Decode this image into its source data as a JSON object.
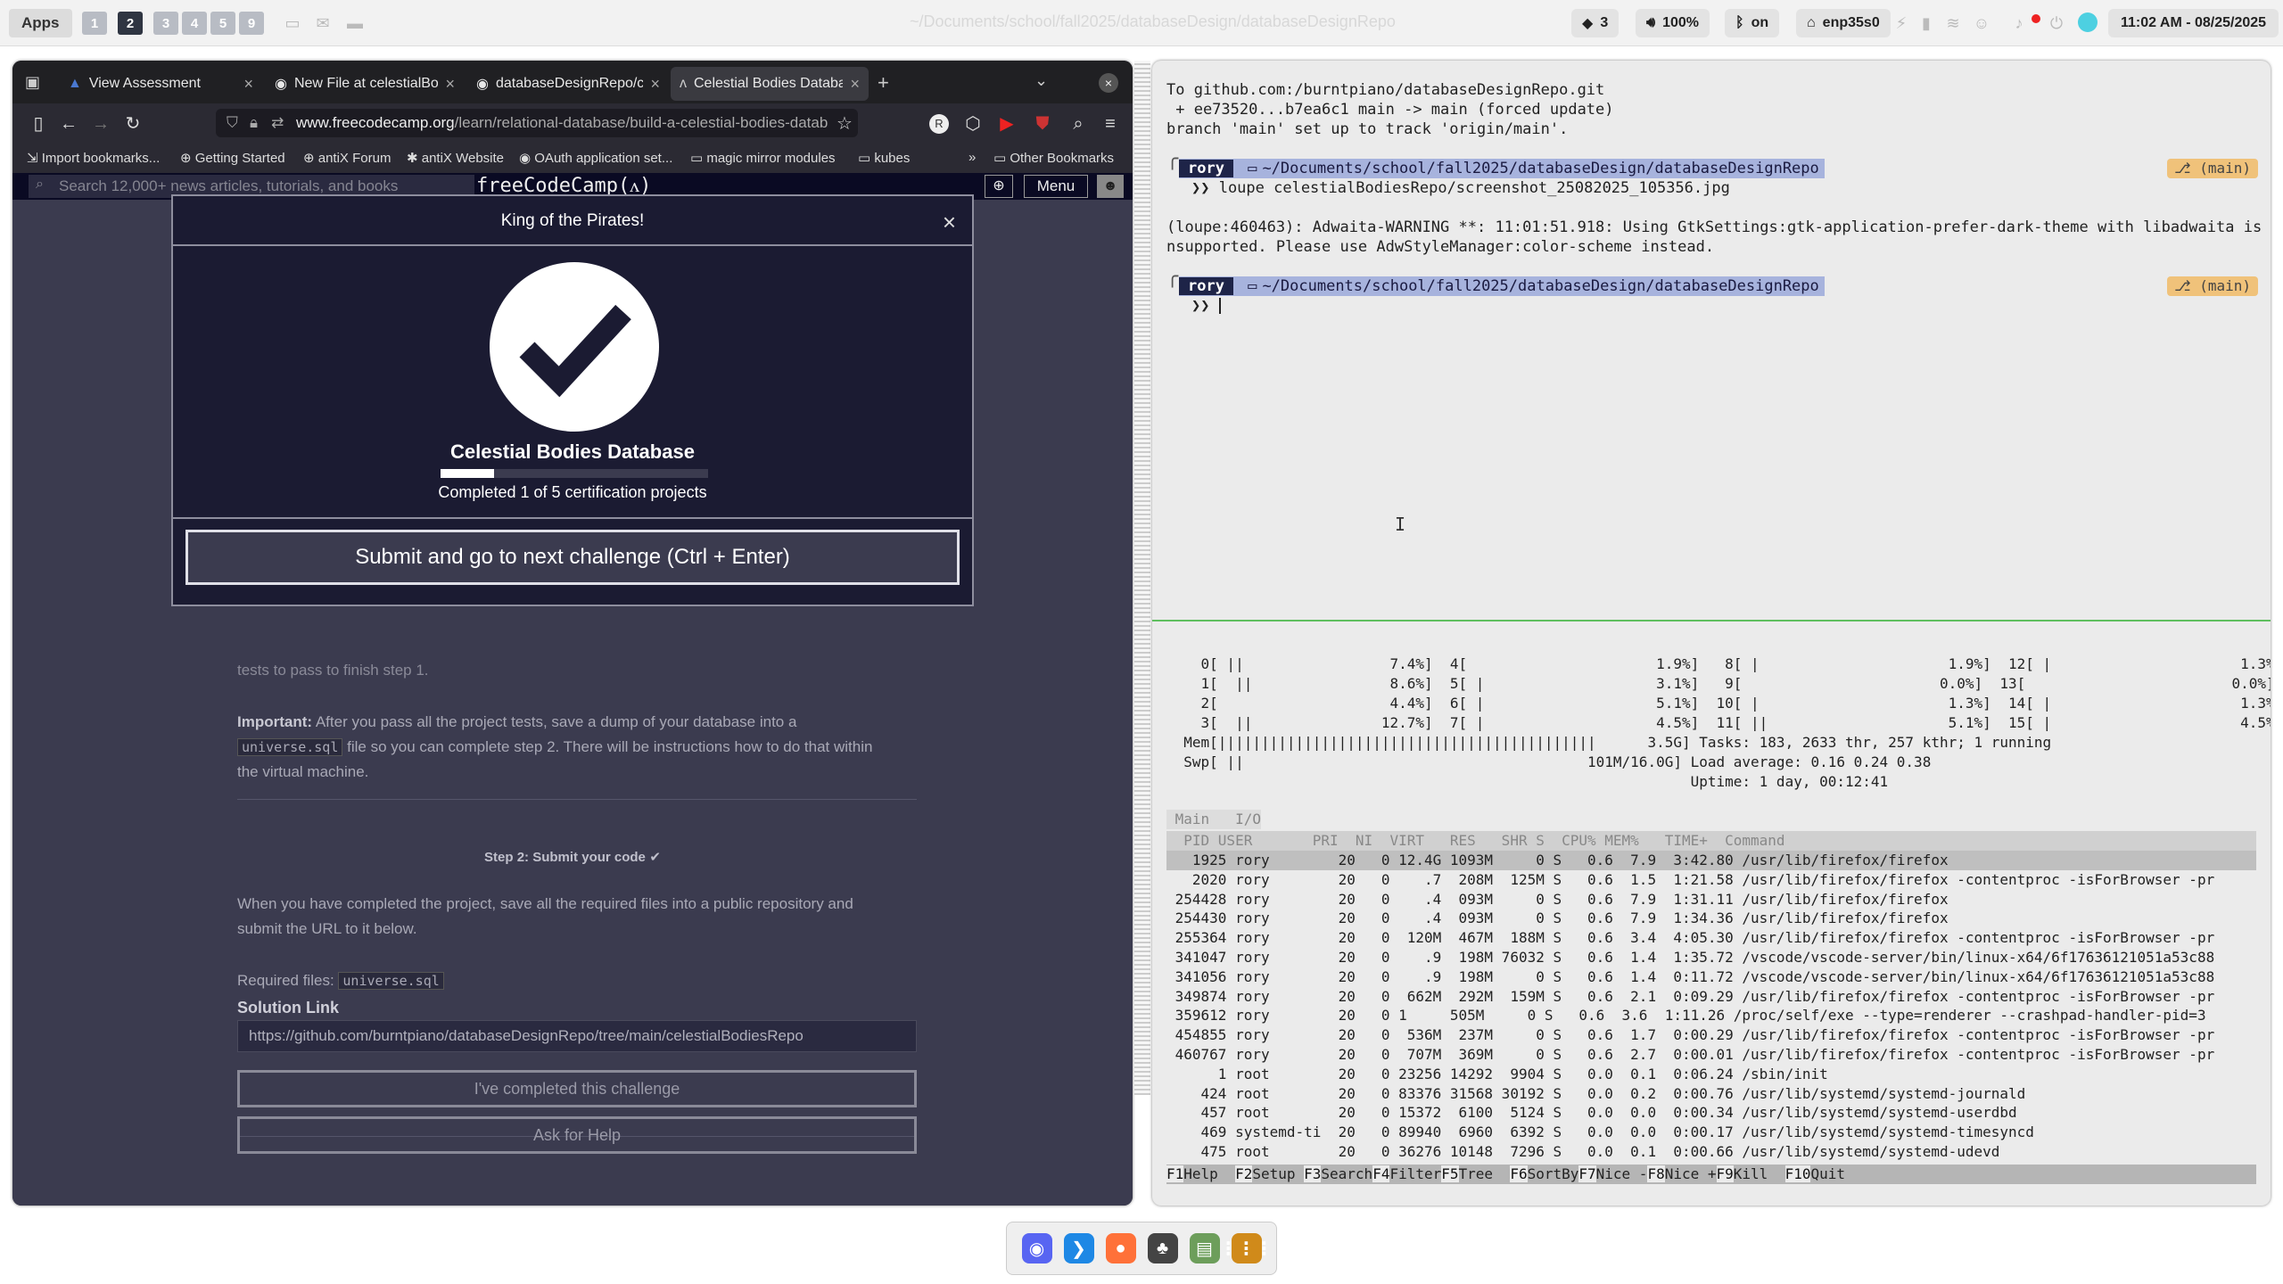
{
  "topbar": {
    "apps_label": "Apps",
    "workspaces": [
      "1",
      "2",
      "3",
      "4",
      "5",
      "9"
    ],
    "window_title": "~/Documents/school/fall2025/databaseDesign/databaseDesignRepo",
    "dropbox_count": "3",
    "volume": "100%",
    "bluetooth": "on",
    "network": "enp35s0",
    "datetime": "11:02 AM - 08/25/2025"
  },
  "browser": {
    "tabs": [
      {
        "label": "View Assessment"
      },
      {
        "label": "New File at celestialBod"
      },
      {
        "label": "databaseDesignRepo/ce"
      },
      {
        "label": "Celestial Bodies Databa"
      }
    ],
    "url_domain": "www.freecodecamp.org",
    "url_path": "/learn/relational-database/build-a-celestial-bodies-datab",
    "bookmarks": [
      "Import bookmarks...",
      "Getting Started",
      "antiX Forum",
      "antiX Website",
      "OAuth application set...",
      "magic mirror modules",
      "kubes"
    ],
    "other_bookmarks": "Other Bookmarks"
  },
  "fcc": {
    "search_placeholder": "Search 12,000+ news articles, tutorials, and books",
    "logo": "freeCodeCamp(ᴧ)",
    "menu_label": "Menu",
    "step1_tail": "tests to pass to finish step 1.",
    "important_label": "Important:",
    "important_text_a": "After you pass all the project tests, save a dump of your database into a",
    "important_code": "universe.sql",
    "important_text_b": "file so you can complete step 2. There will be instructions how to do that within",
    "important_text_c": "the virtual machine.",
    "step2_title": "Step 2: Submit your code",
    "step2_text_a": "When you have completed the project, save all the required files into a public repository and",
    "step2_text_b": "submit the URL to it below.",
    "required_files_label": "Required files:",
    "required_file": "universe.sql",
    "solution_label": "Solution Link",
    "solution_value": "https://github.com/burntpiano/databaseDesignRepo/tree/main/celestialBodiesRepo",
    "completed_button": "I've completed this challenge",
    "help_button": "Ask for Help"
  },
  "modal": {
    "title": "King of the Pirates!",
    "project_title": "Celestial Bodies Database",
    "progress_fraction": 0.2,
    "progress_text": "Completed 1 of 5 certification projects",
    "submit_label": "Submit and go to next challenge (Ctrl + Enter)"
  },
  "terminal": {
    "git_line1": "To github.com:/burntpiano/databaseDesignRepo.git",
    "git_line2": " + ee73520...b7ea6c1 main -> main (forced update)",
    "git_line3": "branch 'main' set up to track 'origin/main'.",
    "prompt_user": "rory",
    "prompt_path": "~/Documents/school/fall2025/databaseDesign/databaseDesignRepo",
    "branch": "(main)",
    "command1": "❯❯ loupe celestialBodiesRepo/screenshot_25082025_105356.jpg",
    "warn_line1": "(loupe:460463): Adwaita-WARNING **: 11:01:51.918: Using GtkSettings:gtk-application-prefer-dark-theme with libadwaita is u",
    "warn_line2": "nsupported. Please use AdwStyleManager:color-scheme instead.",
    "command2": "❯❯ "
  },
  "htop": {
    "cpus": [
      "    0[ ||                 7.4%]  4[                      1.9%]   8[ |                      1.9%]  12[ |                      1.3%]",
      "    1[  ||                8.6%]  5[ |                    3.1%]   9[                       0.0%]  13[                        0.0%]",
      "    2[                    4.4%]  6[ |                    5.1%]  10[ |                      1.3%]  14[ |                      1.3%]",
      "    3[  ||               12.7%]  7[ |                    4.5%]  11[ ||                     5.1%]  15[ |                      4.5%]"
    ],
    "mem_line": "  Mem[||||||||||||||||||||||||||||||||||||||||||||      3.5G] Tasks: 183, 2633 thr, 257 kthr; 1 running",
    "swp_line": "  Swp[ ||                                        101M/16.0G] Load average: 0.16 0.24 0.38",
    "uptime_line": "                                                             Uptime: 1 day, 00:12:41",
    "tabs": " Main   I/O",
    "header": "  PID USER       PRI  NI  VIRT   RES   SHR S  CPU% MEM%   TIME+  Command",
    "processes": [
      "   1925 rory        20   0 12.4G 1093M     0 S   0.6  7.9  3:42.80 /usr/lib/firefox/firefox",
      "   2020 rory        20   0    .7  208M  125M S   0.6  1.5  1:21.58 /usr/lib/firefox/firefox -contentproc -isForBrowser -pr",
      " 254428 rory        20   0    .4  093M     0 S   0.6  7.9  1:31.11 /usr/lib/firefox/firefox",
      " 254430 rory        20   0    .4  093M     0 S   0.6  7.9  1:34.36 /usr/lib/firefox/firefox",
      " 255364 rory        20   0  120M  467M  188M S   0.6  3.4  4:05.30 /usr/lib/firefox/firefox -contentproc -isForBrowser -pr",
      " 341047 rory        20   0    .9  198M 76032 S   0.6  1.4  1:35.72 /vscode/vscode-server/bin/linux-x64/6f17636121051a53c88",
      " 341056 rory        20   0    .9  198M     0 S   0.6  1.4  0:11.72 /vscode/vscode-server/bin/linux-x64/6f17636121051a53c88",
      " 349874 rory        20   0  662M  292M  159M S   0.6  2.1  0:09.29 /usr/lib/firefox/firefox -contentproc -isForBrowser -pr",
      " 359612 rory        20   0 1     505M     0 S   0.6  3.6  1:11.26 /proc/self/exe --type=renderer --crashpad-handler-pid=3",
      " 454855 rory        20   0  536M  237M     0 S   0.6  1.7  0:00.29 /usr/lib/firefox/firefox -contentproc -isForBrowser -pr",
      " 460767 rory        20   0  707M  369M     0 S   0.6  2.7  0:00.01 /usr/lib/firefox/firefox -contentproc -isForBrowser -pr",
      "      1 root        20   0 23256 14292  9904 S   0.0  0.1  0:06.24 /sbin/init",
      "    424 root        20   0 83376 31568 30192 S   0.0  0.2  0:00.76 /usr/lib/systemd/systemd-journald",
      "    457 root        20   0 15372  6100  5124 S   0.0  0.0  0:00.34 /usr/lib/systemd/systemd-userdbd",
      "    469 systemd-ti  20   0 89940  6960  6392 S   0.0  0.0  0:00.17 /usr/lib/systemd/systemd-timesyncd",
      "    475 root        20   0 36276 10148  7296 S   0.0  0.1  0:00.66 /usr/lib/systemd/systemd-udevd"
    ],
    "fkeys": [
      {
        "k": "F1",
        "v": "Help  "
      },
      {
        "k": "F2",
        "v": "Setup "
      },
      {
        "k": "F3",
        "v": "Search"
      },
      {
        "k": "F4",
        "v": "Filter"
      },
      {
        "k": "F5",
        "v": "Tree  "
      },
      {
        "k": "F6",
        "v": "SortBy"
      },
      {
        "k": "F7",
        "v": "Nice -"
      },
      {
        "k": "F8",
        "v": "Nice +"
      },
      {
        "k": "F9",
        "v": "Kill  "
      },
      {
        "k": "F10",
        "v": "Quit"
      }
    ]
  },
  "dock": {
    "apps": [
      {
        "icon": "discord-icon",
        "color": "#5865f2",
        "glyph": "◉"
      },
      {
        "icon": "vscode-icon",
        "color": "#1e88e5",
        "glyph": "❯"
      },
      {
        "icon": "firefox-icon",
        "color": "#ff7139",
        "glyph": "●"
      },
      {
        "icon": "game-icon",
        "color": "#444",
        "glyph": "♣"
      },
      {
        "icon": "files-icon",
        "color": "#6d9e5b",
        "glyph": "▤"
      },
      {
        "icon": "grid-icon",
        "color": "#d08a1a",
        "glyph": "⋮⋮⋮"
      }
    ]
  }
}
